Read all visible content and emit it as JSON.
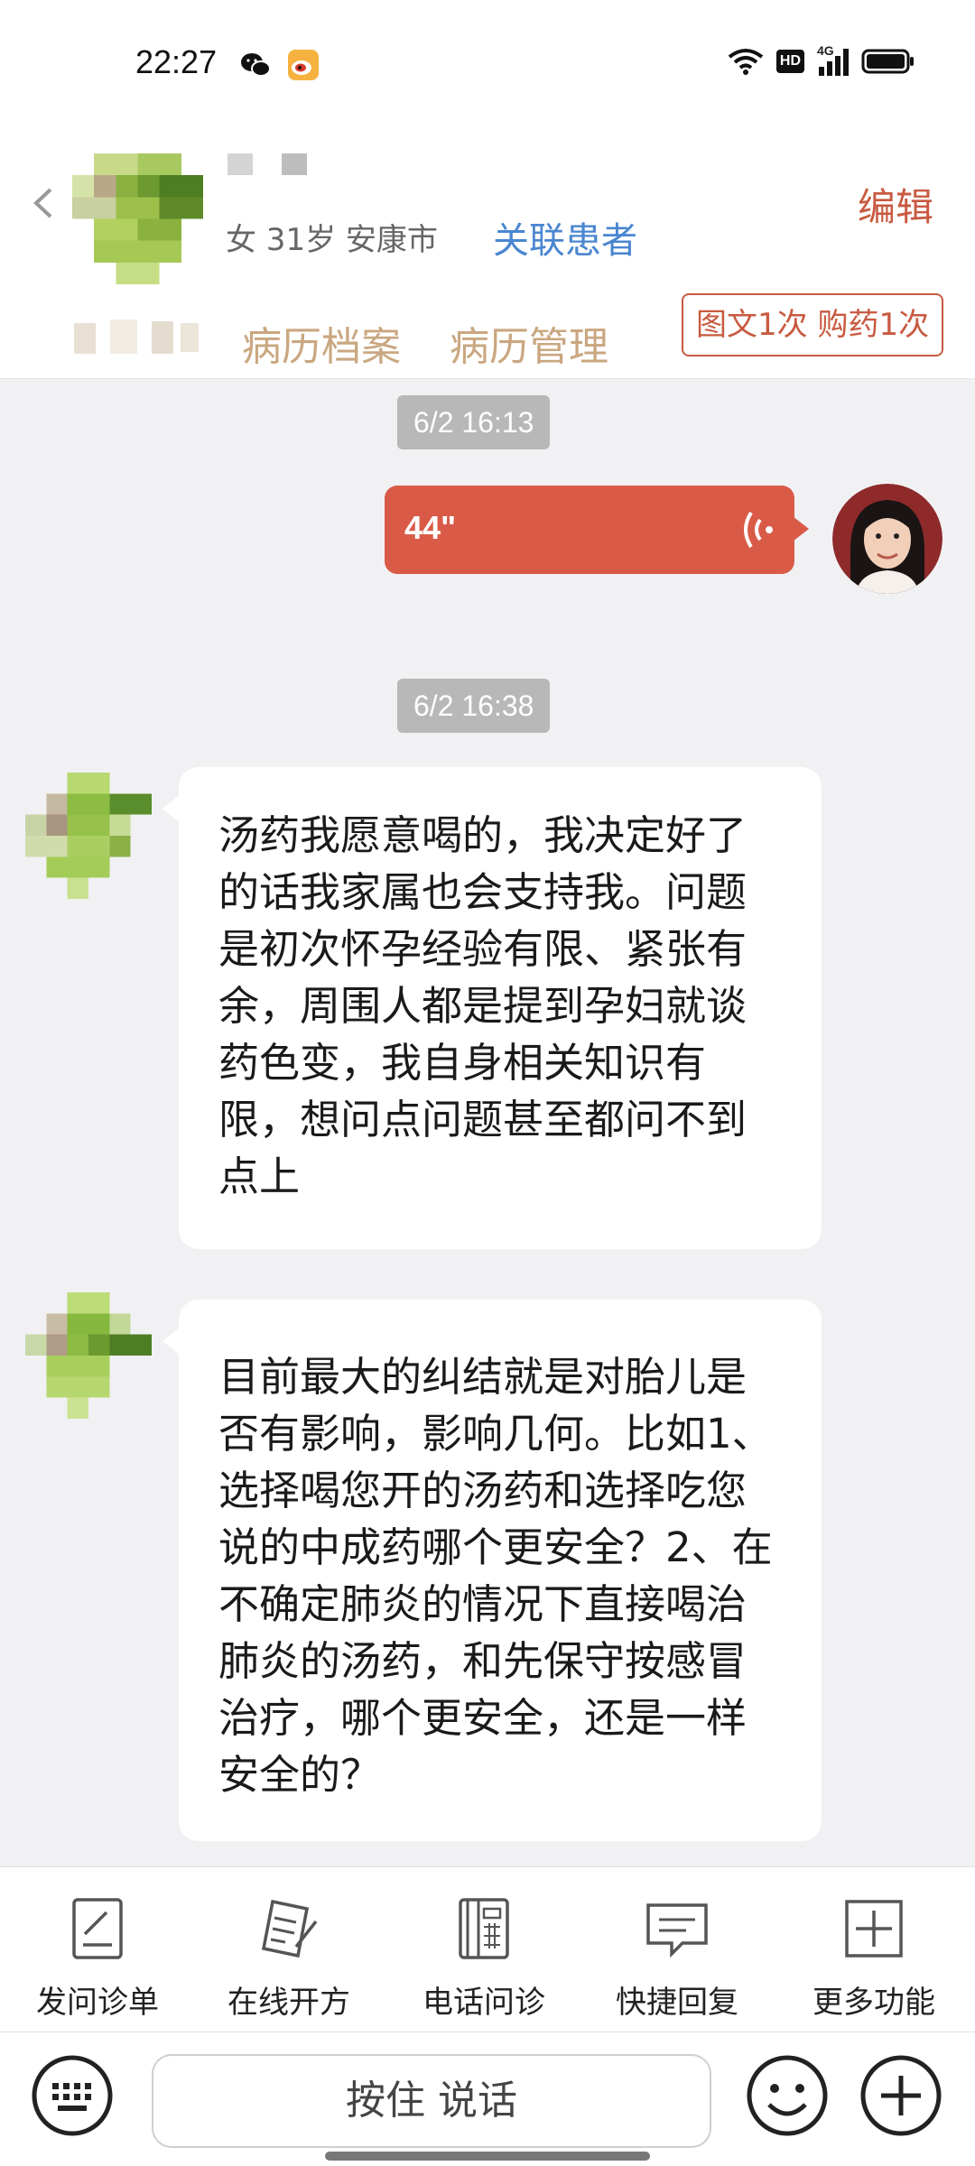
{
  "status_bar": {
    "time": "22:27",
    "network_label": "4G",
    "hd_label": "HD"
  },
  "patient": {
    "meta": "女 31岁  安康市",
    "link_label": "关联患者"
  },
  "header": {
    "edit_label": "编辑",
    "tabs": [
      "病历档案",
      "病历管理"
    ],
    "service_badge": "图文1次 购药1次"
  },
  "chat": {
    "messages": [
      {
        "type": "timestamp",
        "text": "6/2 16:13"
      },
      {
        "type": "voice",
        "sender": "doctor",
        "duration": "44\""
      },
      {
        "type": "timestamp",
        "text": "6/2 16:38"
      },
      {
        "type": "text",
        "sender": "patient",
        "text": "汤药我愿意喝的，我决定好了的话我家属也会支持我。问题是初次怀孕经验有限、紧张有余，周围人都是提到孕妇就谈药色变，我自身相关知识有限，想问点问题甚至都问不到点上"
      },
      {
        "type": "text",
        "sender": "patient",
        "text": "目前最大的纠结就是对胎儿是否有影响，影响几何。比如1、选择喝您开的汤药和选择吃您说的中成药哪个更安全？2、在不确定肺炎的情况下直接喝治肺炎的汤药，和先保守按感冒治疗，哪个更安全，还是一样安全的？"
      }
    ]
  },
  "toolbar": {
    "items": [
      {
        "label": "发问诊单",
        "icon": "form-icon"
      },
      {
        "label": "在线开方",
        "icon": "prescription-icon"
      },
      {
        "label": "电话问诊",
        "icon": "phone-icon"
      },
      {
        "label": "快捷回复",
        "icon": "quick-reply-icon"
      },
      {
        "label": "更多功能",
        "icon": "more-icon"
      }
    ]
  },
  "input_bar": {
    "hold_to_talk_label": "按住 说话"
  },
  "colors": {
    "accent_red": "#d95b47",
    "link_blue": "#4a86d0",
    "tab_tan": "#c9a780"
  }
}
